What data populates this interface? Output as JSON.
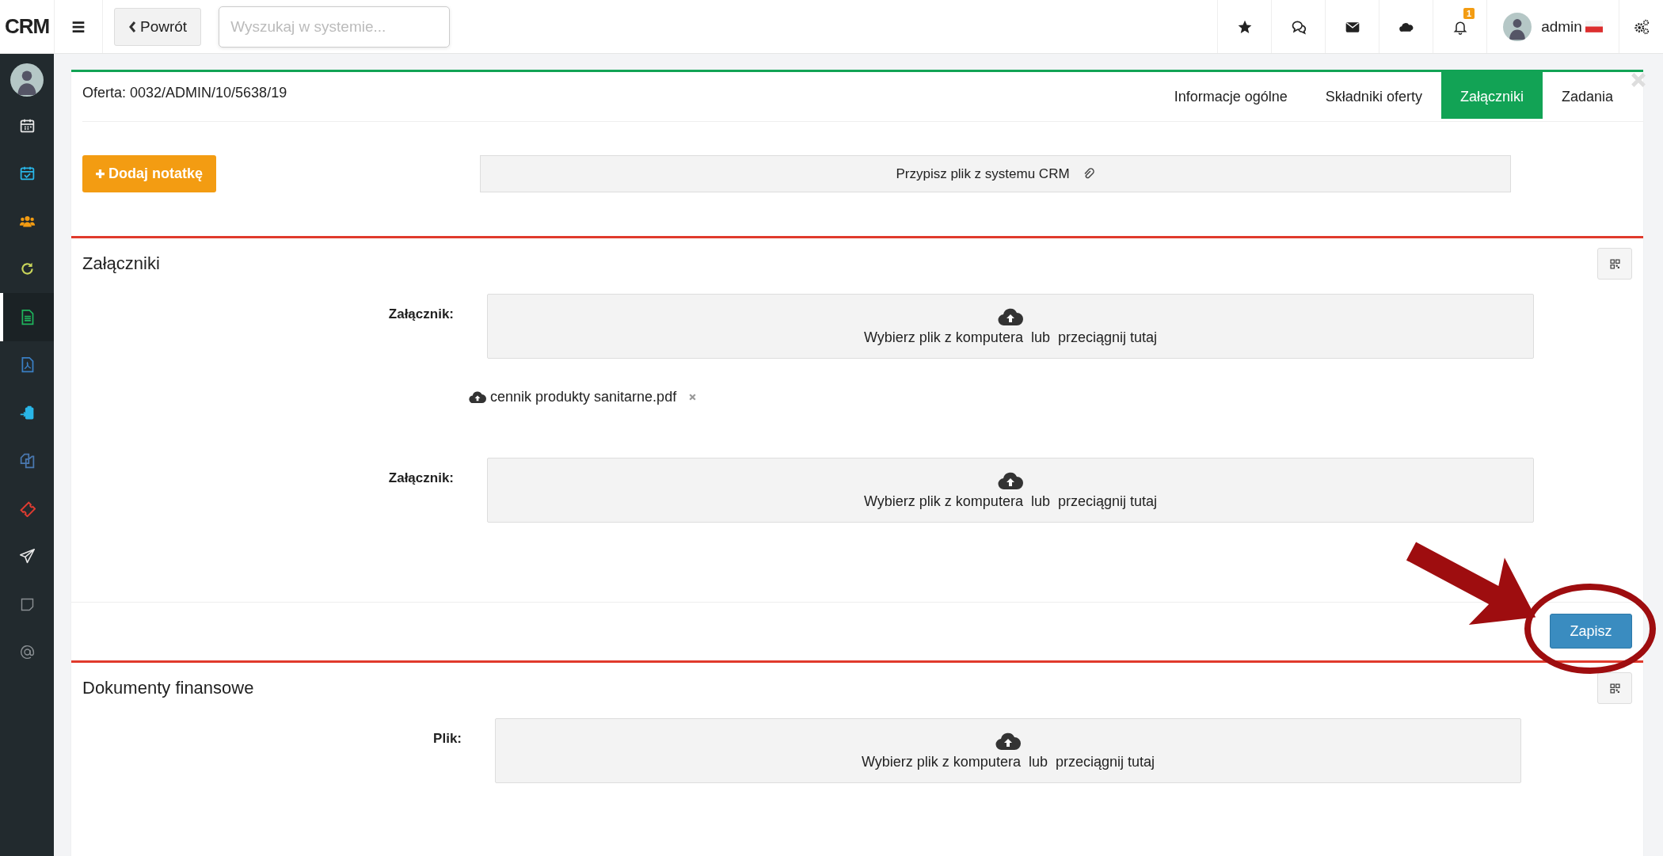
{
  "topbar": {
    "logo": "CRM",
    "back_button": "Powrót",
    "search": {
      "placeholder": "Wyszukaj w systemie..."
    },
    "icons": [
      {
        "kind": "star"
      },
      {
        "kind": "chat"
      },
      {
        "kind": "envelope"
      },
      {
        "kind": "cloud"
      },
      {
        "kind": "bell",
        "badge": "1"
      }
    ],
    "user": {
      "name": "admin"
    }
  },
  "sidebar": {
    "items": [
      {
        "kind": "calendar",
        "color": "#e8e8e8",
        "selected": false
      },
      {
        "kind": "calendar-check",
        "color": "#29b6e8",
        "selected": false
      },
      {
        "kind": "users",
        "color": "#f39c12",
        "selected": false
      },
      {
        "kind": "refresh",
        "color": "#c8d45a",
        "selected": false
      },
      {
        "kind": "document",
        "color": "#1fb35c",
        "selected": true
      },
      {
        "kind": "pdf",
        "color": "#3a7fc4",
        "selected": false
      },
      {
        "kind": "clipboard",
        "color": "#29b6e8",
        "selected": false
      },
      {
        "kind": "copy",
        "color": "#4a78b0",
        "selected": false
      },
      {
        "kind": "ticket",
        "color": "#e03c31",
        "selected": false
      },
      {
        "kind": "plane",
        "color": "#e8e8e8",
        "selected": false
      },
      {
        "kind": "note",
        "color": "#8a8f93",
        "selected": false
      },
      {
        "kind": "at",
        "color": "#8a8f93",
        "selected": false
      }
    ]
  },
  "offer": {
    "title": "Oferta: 0032/ADMIN/10/5638/19",
    "tabs": [
      {
        "label": "Informacje ogólne",
        "selected": false
      },
      {
        "label": "Składniki oferty",
        "selected": false
      },
      {
        "label": "Załączniki",
        "selected": true
      },
      {
        "label": "Zadania",
        "selected": false
      }
    ],
    "add_note_button": "Dodaj notatkę",
    "assign_file_button": "Przypisz plik z systemu CRM"
  },
  "attachments": {
    "title": "Załączniki",
    "fields": [
      {
        "label": "Załącznik:",
        "dropzone": "Wybierz plik z komputera  lub  przeciągnij tutaj",
        "files": [
          "cennik produkty sanitarne.pdf"
        ]
      },
      {
        "label": "Załącznik:",
        "dropzone": "Wybierz plik z komputera  lub  przeciągnij tutaj"
      }
    ],
    "save_button": "Zapisz"
  },
  "financial_documents": {
    "title": "Dokumenty finansowe",
    "fields": [
      {
        "label": "Plik:",
        "dropzone": "Wybierz plik z komputera  lub  przeciągnij tutaj"
      }
    ]
  }
}
